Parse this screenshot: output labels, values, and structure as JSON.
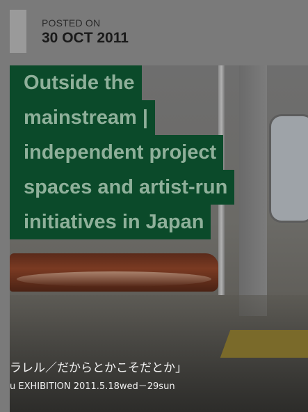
{
  "post_meta": {
    "label": "POSTED ON",
    "date": "30 OCT 2011"
  },
  "post": {
    "title_lines": [
      "Outside the",
      "mainstream |",
      "independent project",
      "spaces and artist-run",
      "initiatives in Japan"
    ]
  },
  "featured_image": {
    "poster_text_line1": "ラレル／だからとかこそだとか」",
    "poster_text_line2": "u EXHIBITION   2011.5.18wed－29sun"
  },
  "colors": {
    "title_background": "#0b4a2a",
    "title_text": "#8fb09a"
  }
}
